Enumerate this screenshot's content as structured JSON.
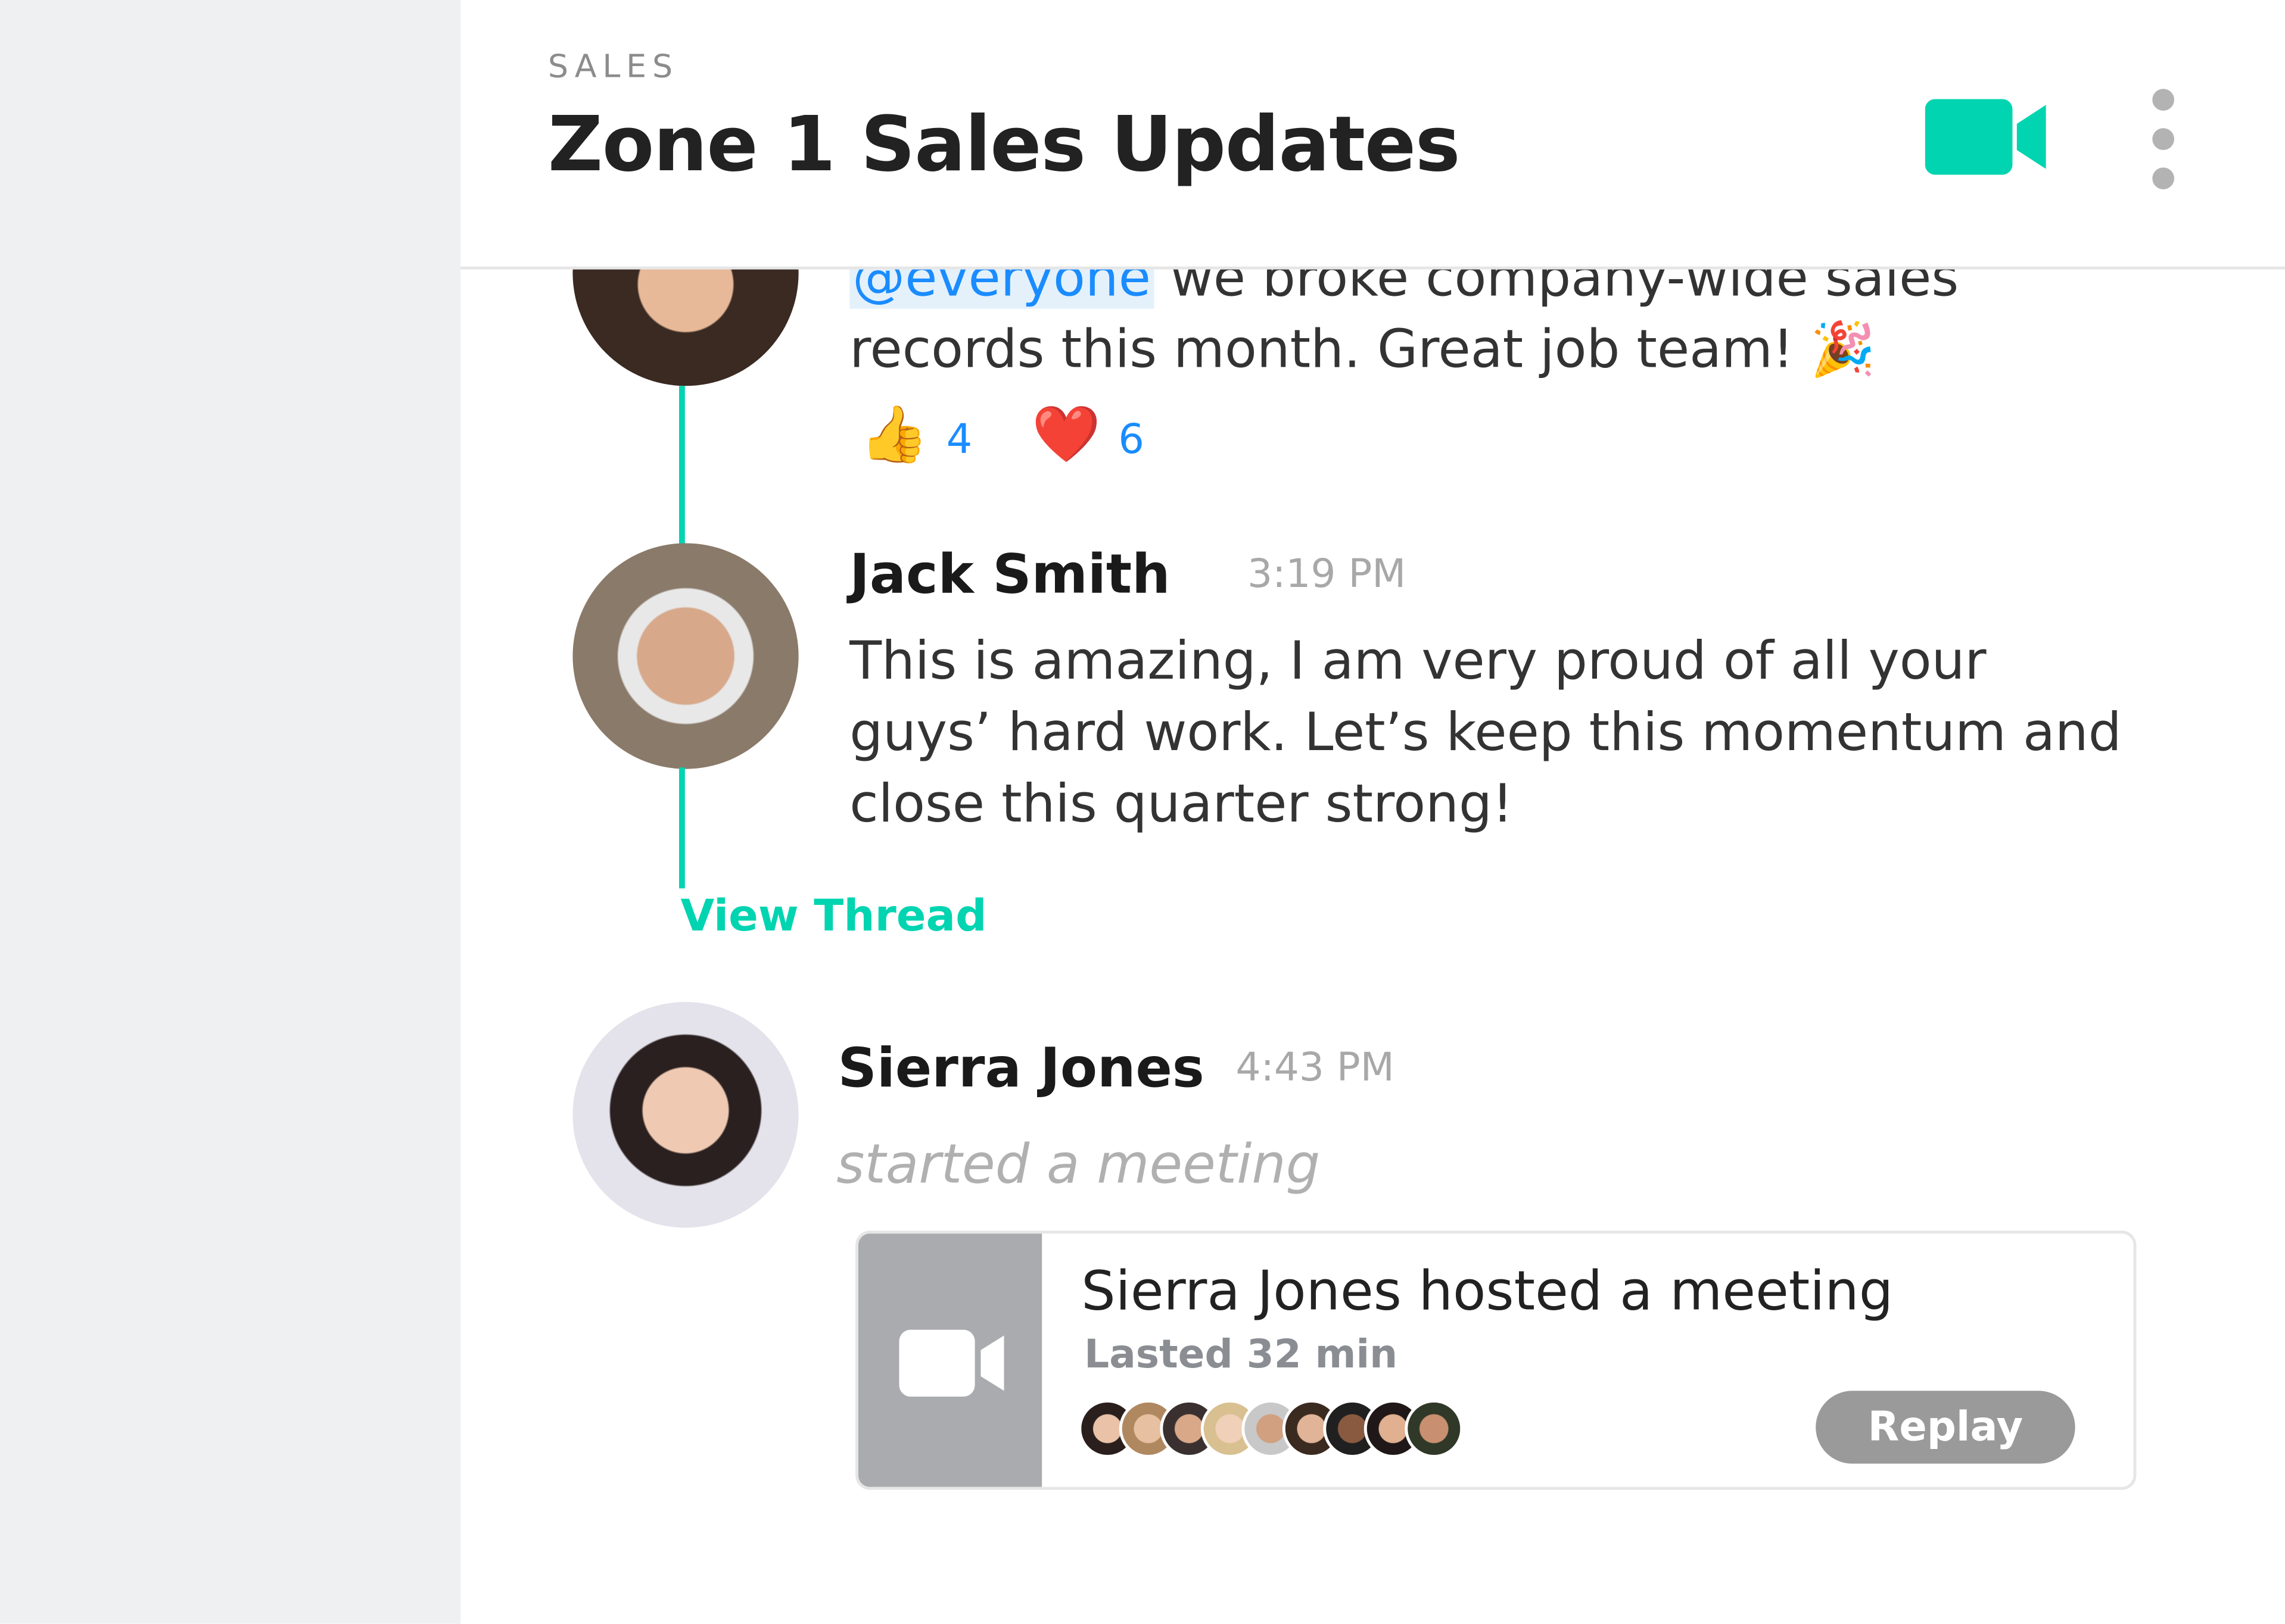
{
  "colors": {
    "accent": "#00d4b0",
    "mention": "#1a8cff",
    "sidebar": "#eef0f2",
    "replay_bg": "#9a9a9a"
  },
  "header": {
    "channel_category": "SALES",
    "channel_title": "Zone 1 Sales Updates",
    "video_icon": "video-camera-icon",
    "more_icon": "vertical-ellipsis-icon"
  },
  "messages": [
    {
      "mention": "@everyone",
      "text_line1": " we broke company-wide sales",
      "text_line2": "records this month. Great job team! 🎉",
      "reactions": [
        {
          "emoji": "👍",
          "count": "4"
        },
        {
          "emoji": "❤️",
          "count": "6"
        }
      ]
    },
    {
      "author": "Jack Smith",
      "time": "3:19 PM",
      "lines": [
        "This is amazing, I am very proud of all your",
        "guys’ hard work. Let’s keep this momentum and",
        "close this quarter strong!"
      ]
    }
  ],
  "thread": {
    "view_label": "View Thread"
  },
  "meeting_message": {
    "author": "Sierra Jones",
    "time": "4:43 PM",
    "action": "started a meeting",
    "card": {
      "title": "Sierra Jones hosted a meeting",
      "duration": "Lasted 32 min",
      "participants_count": 9,
      "replay_label": "Replay"
    }
  }
}
